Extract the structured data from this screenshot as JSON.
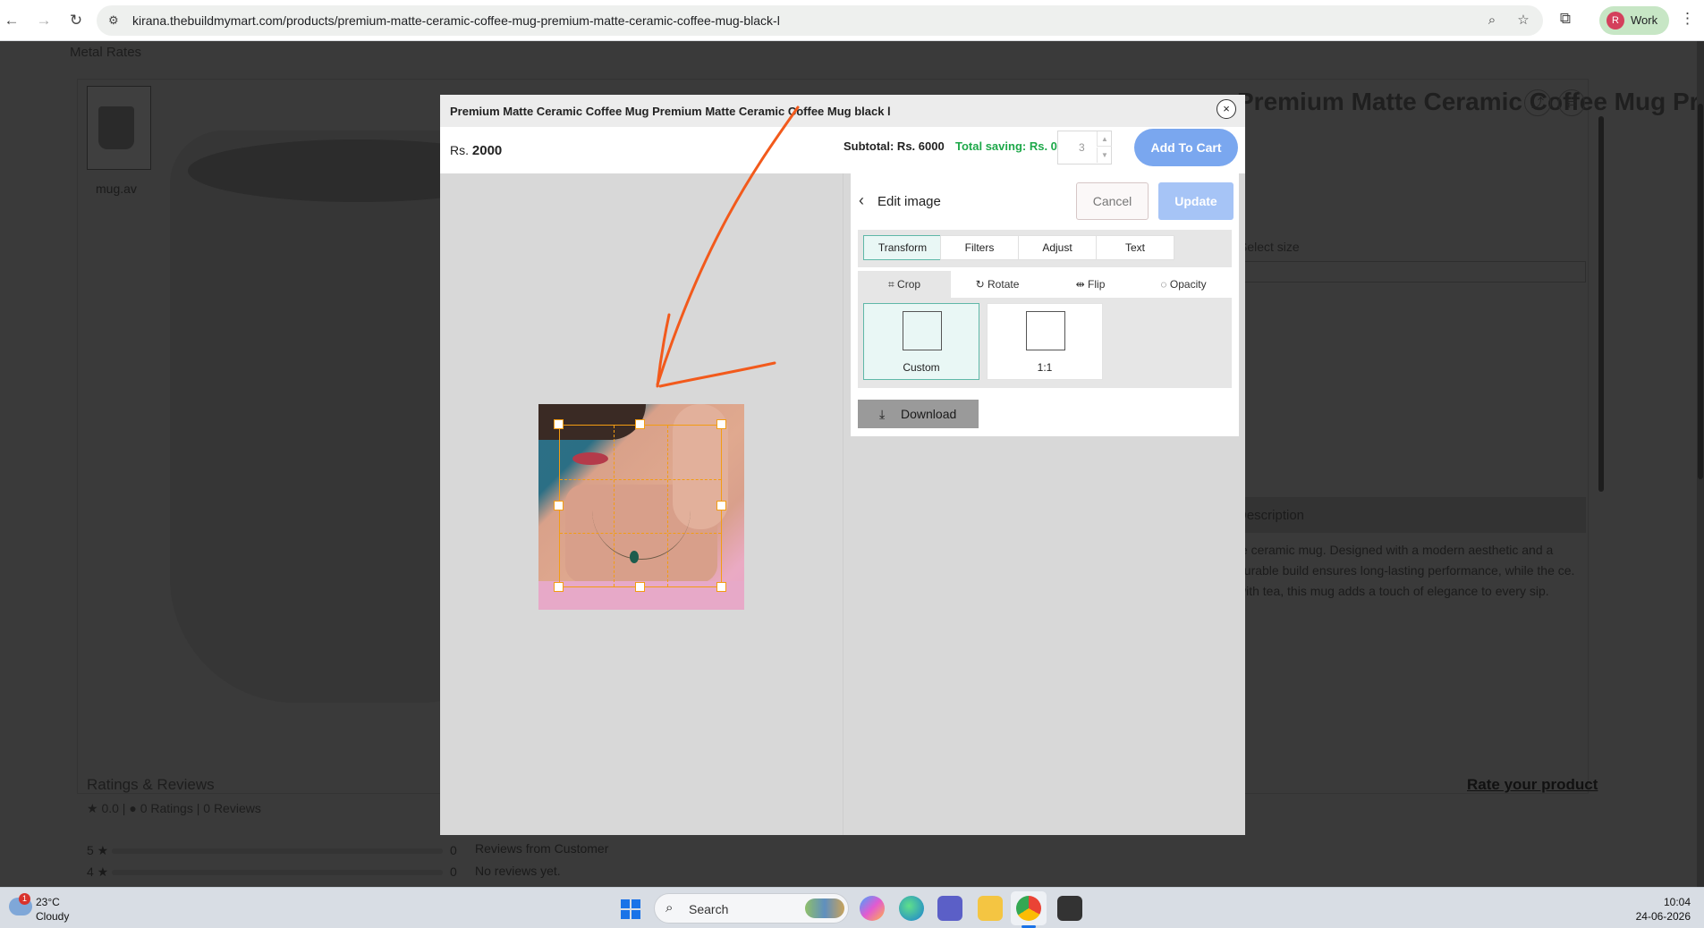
{
  "browser": {
    "url": "kirana.thebuildmymart.com/products/premium-matte-ceramic-coffee-mug-premium-matte-ceramic-coffee-mug-black-l",
    "profile_initial": "R",
    "profile_label": "Work"
  },
  "page": {
    "metal_rates": "Metal Rates",
    "thumb_alt": "mug.av",
    "product_title_right": "Premium Matte Ceramic Coffee Mug Premium Matte",
    "select_size": "Select size",
    "description_head": "Description",
    "description": "te ceramic mug. Designed with a modern aesthetic and a durable build ensures long-lasting performance, while the ce. with tea, this mug adds a touch of elegance to every sip.",
    "ratings_title": "Ratings & Reviews",
    "rating_value": "0.0",
    "rating_counts": "0 Ratings | 0 Reviews",
    "rate_link": "Rate your product",
    "bars": [
      {
        "label": "5 ★",
        "count": "0"
      },
      {
        "label": "4 ★",
        "count": "0"
      }
    ],
    "reviews_from": "Reviews from Customer",
    "no_reviews": "No reviews yet."
  },
  "modal": {
    "title": "Premium Matte Ceramic Coffee Mug Premium Matte Ceramic Coffee Mug black l",
    "close": "×",
    "price_prefix": "Rs.",
    "price_value": "2000",
    "subtotal": "Subtotal: Rs. 6000",
    "total_saving": "Total saving: Rs. 0",
    "quantity": "3",
    "add_to_cart": "Add To Cart"
  },
  "editor": {
    "title": "Edit image",
    "cancel": "Cancel",
    "update": "Update",
    "main_tabs": [
      "Transform",
      "Filters",
      "Adjust",
      "Text"
    ],
    "active_main_tab": "Transform",
    "sub_tabs": [
      "Crop",
      "Rotate",
      "Flip",
      "Opacity"
    ],
    "active_sub_tab": "Crop",
    "presets": [
      "Custom",
      "1:1"
    ],
    "active_preset": "Custom",
    "download": "Download"
  },
  "taskbar": {
    "weather_badge": "1",
    "temperature": "23°C",
    "condition": "Cloudy",
    "search_placeholder": "Search",
    "time": "10:04",
    "date": "24-06-2026"
  },
  "colors": {
    "add_to_cart": "#7aa7ef",
    "saving_green": "#1ea84a",
    "crop_orange": "#f39c12",
    "annotation_arrow": "#f25a1c"
  }
}
